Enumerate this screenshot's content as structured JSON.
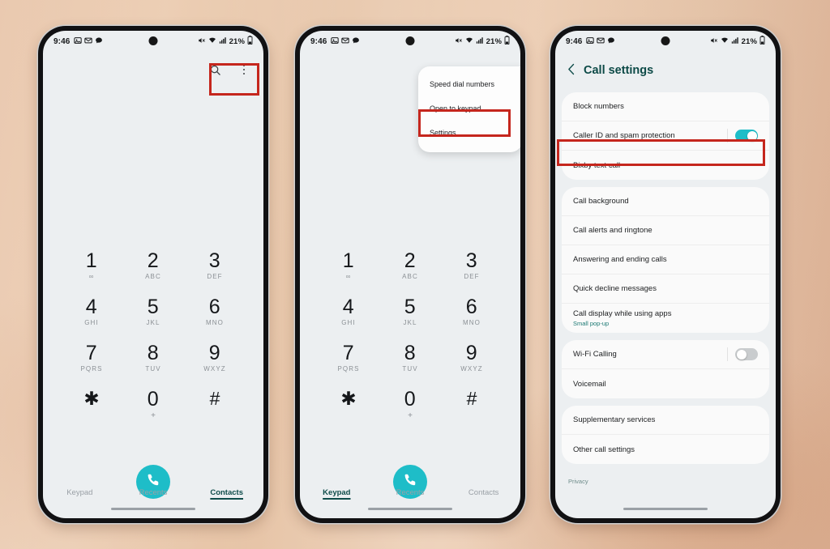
{
  "colors": {
    "accent_teal": "#1ebdc8",
    "header_teal": "#0d4a47",
    "highlight_red": "#c5261d",
    "screen_bg": "#eceff1",
    "card_bg": "#fafafa",
    "subtitle_teal": "#1d7a74",
    "page_background": "#e8c4a8"
  },
  "status_bar": {
    "time": "9:46",
    "left_icons": [
      "gallery-icon",
      "mail-icon",
      "messages-icon"
    ],
    "right_icons": [
      "mute-icon",
      "wifi-icon",
      "signal-icon"
    ],
    "battery_percent": "21%",
    "battery_icon": "battery-icon"
  },
  "phone1": {
    "name": "Phone app keypad screen",
    "toolbar": {
      "search_icon": "search-icon",
      "menu_icon": "more-options-kebab-icon"
    },
    "highlight": "search and more options buttons",
    "keypad": [
      {
        "num": "1",
        "sub": "∞"
      },
      {
        "num": "2",
        "sub": "ABC"
      },
      {
        "num": "3",
        "sub": "DEF"
      },
      {
        "num": "4",
        "sub": "GHI"
      },
      {
        "num": "5",
        "sub": "JKL"
      },
      {
        "num": "6",
        "sub": "MNO"
      },
      {
        "num": "7",
        "sub": "PQRS"
      },
      {
        "num": "8",
        "sub": "TUV"
      },
      {
        "num": "9",
        "sub": "WXYZ"
      },
      {
        "num": "✱",
        "sub": ""
      },
      {
        "num": "0",
        "sub": "+"
      },
      {
        "num": "#",
        "sub": ""
      }
    ],
    "call_button": "call-icon",
    "tabs": [
      {
        "label": "Keypad",
        "active": false
      },
      {
        "label": "Recents",
        "active": false
      },
      {
        "label": "Contacts",
        "active": true
      }
    ]
  },
  "phone2": {
    "name": "Phone app with overflow menu open",
    "menu": {
      "items": [
        {
          "label": "Speed dial numbers",
          "highlighted": false
        },
        {
          "label": "Open to keypad",
          "highlighted": false
        },
        {
          "label": "Settings",
          "highlighted": true
        }
      ]
    },
    "keypad": [
      {
        "num": "1",
        "sub": "∞"
      },
      {
        "num": "2",
        "sub": "ABC"
      },
      {
        "num": "3",
        "sub": "DEF"
      },
      {
        "num": "4",
        "sub": "GHI"
      },
      {
        "num": "5",
        "sub": "JKL"
      },
      {
        "num": "6",
        "sub": "MNO"
      },
      {
        "num": "7",
        "sub": "PQRS"
      },
      {
        "num": "8",
        "sub": "TUV"
      },
      {
        "num": "9",
        "sub": "WXYZ"
      },
      {
        "num": "✱",
        "sub": ""
      },
      {
        "num": "0",
        "sub": "+"
      },
      {
        "num": "#",
        "sub": ""
      }
    ],
    "call_button": "call-icon",
    "tabs": [
      {
        "label": "Keypad",
        "active": true
      },
      {
        "label": "Recents",
        "active": false
      },
      {
        "label": "Contacts",
        "active": false
      }
    ]
  },
  "phone3": {
    "name": "Call settings screen",
    "header": {
      "back_icon": "back-chevron-icon",
      "title": "Call settings"
    },
    "group1": [
      {
        "label": "Block numbers",
        "sub": "",
        "control": "none",
        "highlighted": false
      },
      {
        "label": "Caller ID and spam protection",
        "sub": "",
        "control": "toggle-on",
        "highlighted": true
      },
      {
        "label": "Bixby text call",
        "sub": "",
        "control": "none",
        "highlighted": false
      }
    ],
    "group2": [
      {
        "label": "Call background",
        "sub": "",
        "control": "none"
      },
      {
        "label": "Call alerts and ringtone",
        "sub": "",
        "control": "none"
      },
      {
        "label": "Answering and ending calls",
        "sub": "",
        "control": "none"
      },
      {
        "label": "Quick decline messages",
        "sub": "",
        "control": "none"
      },
      {
        "label": "Call display while using apps",
        "sub": "Small pop-up",
        "control": "none"
      }
    ],
    "group3": [
      {
        "label": "Wi-Fi Calling",
        "sub": "",
        "control": "toggle-off"
      },
      {
        "label": "Voicemail",
        "sub": "",
        "control": "none"
      }
    ],
    "group4": [
      {
        "label": "Supplementary services",
        "sub": "",
        "control": "none"
      },
      {
        "label": "Other call settings",
        "sub": "",
        "control": "none"
      }
    ],
    "footer": "Privacy"
  }
}
